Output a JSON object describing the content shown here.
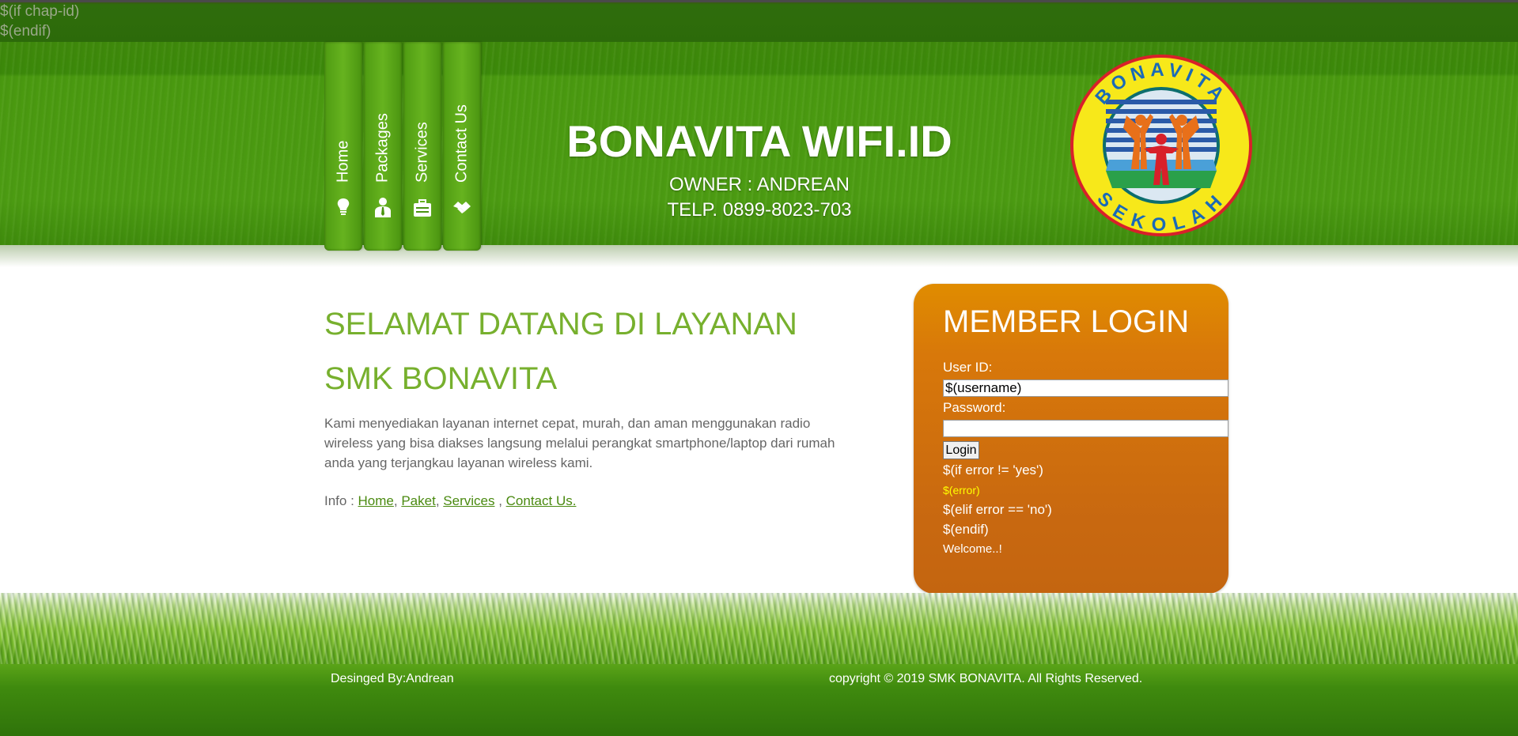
{
  "template_lines": [
    "$(if chap-id)",
    "$(endif)"
  ],
  "nav": [
    {
      "label": "Home",
      "icon": "lightbulb-icon"
    },
    {
      "label": "Packages",
      "icon": "person-tie-icon"
    },
    {
      "label": "Services",
      "icon": "briefcase-icon"
    },
    {
      "label": "Contact Us",
      "icon": "handshake-icon"
    }
  ],
  "brand": {
    "title": "BONAVITA WIFI.ID",
    "owner": "OWNER : ANDREAN",
    "phone": "TELP. 0899-8023-703"
  },
  "logo": {
    "top_text": "BONAVITA",
    "bottom_text": "SEKOLAH"
  },
  "welcome": {
    "title_line1": "SELAMAT DATANG DI LAYANAN",
    "title_line2": "SMK BONAVITA",
    "paragraph": "Kami menyediakan layanan internet cepat, murah, dan aman menggunakan radio wireless yang bisa diakses langsung melalui perangkat smartphone/laptop dari rumah anda yang terjangkau layanan wireless kami.",
    "info_prefix": "Info : ",
    "links": [
      "Home",
      "Paket",
      "Services",
      "Contact Us."
    ]
  },
  "login": {
    "title": "MEMBER LOGIN",
    "user_label": "User ID:",
    "user_value": "$(username)",
    "password_label": "Password:",
    "password_value": "",
    "button_label": "Login",
    "if_error": "$(if error != 'yes')",
    "error": "$(error)",
    "elif_error": "$(elif error == 'no')",
    "endif": "$(endif)",
    "welcome": "Welcome..!"
  },
  "footer": {
    "designed_by": "Desinged By:Andrean",
    "copyright": "copyright © 2019 SMK BONAVITA. All Rights Reserved."
  },
  "colors": {
    "header_green": "#4c9c12",
    "title_green": "#77b02e",
    "login_orange": "#d8780a",
    "error_yellow": "#ffff00"
  }
}
